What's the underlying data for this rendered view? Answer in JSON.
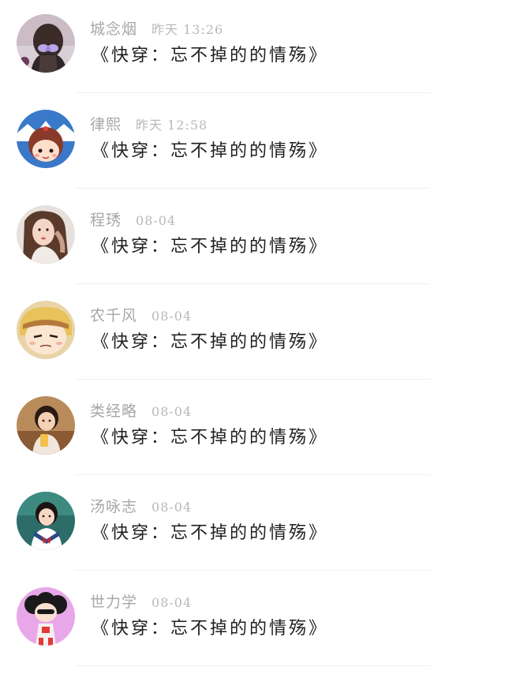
{
  "messages": [
    {
      "name": "城念烟",
      "time": "昨天 13:26",
      "text": "《快穿：忘不掉的的情殇》",
      "avatar_icon": "girl-bow-avatar-icon"
    },
    {
      "name": "律熙",
      "time": "昨天 12:58",
      "text": "《快穿：忘不掉的的情殇》",
      "avatar_icon": "cartoon-girl-avatar-icon"
    },
    {
      "name": "程琇",
      "time": "08-04",
      "text": "《快穿：忘不掉的的情殇》",
      "avatar_icon": "woman-portrait-avatar-icon"
    },
    {
      "name": "农千风",
      "time": "08-04",
      "text": "《快穿：忘不掉的的情殇》",
      "avatar_icon": "anime-boy-avatar-icon"
    },
    {
      "name": "类经略",
      "time": "08-04",
      "text": "《快穿：忘不掉的的情殇》",
      "avatar_icon": "child-drink-avatar-icon"
    },
    {
      "name": "汤咏志",
      "time": "08-04",
      "text": "《快穿：忘不掉的的情殇》",
      "avatar_icon": "sailor-girl-avatar-icon"
    },
    {
      "name": "世力学",
      "time": "08-04",
      "text": "《快穿：忘不掉的的情殇》",
      "avatar_icon": "cartoon-pink-avatar-icon"
    }
  ]
}
